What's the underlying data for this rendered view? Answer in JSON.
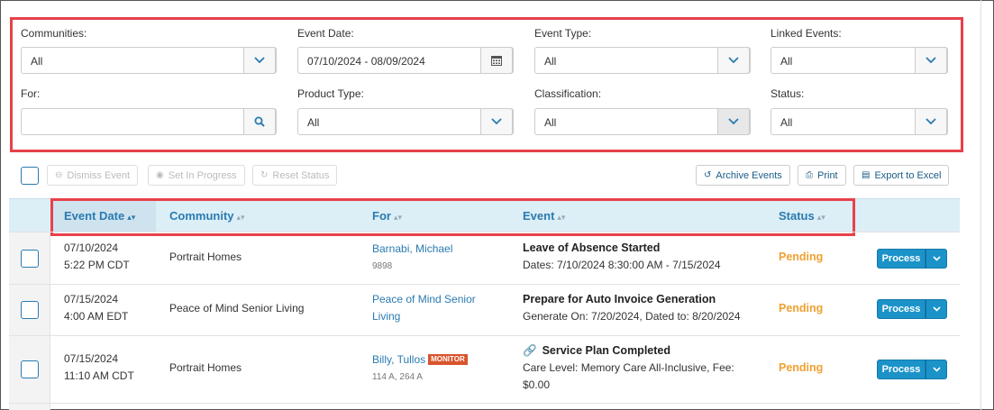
{
  "filters": {
    "communities": {
      "label": "Communities:",
      "value": "All"
    },
    "event_date": {
      "label": "Event Date:",
      "value": "07/10/2024 - 08/09/2024"
    },
    "event_type": {
      "label": "Event Type:",
      "value": "All"
    },
    "linked_events": {
      "label": "Linked Events:",
      "value": "All"
    },
    "for": {
      "label": "For:",
      "value": ""
    },
    "product_type": {
      "label": "Product Type:",
      "value": "All"
    },
    "classification": {
      "label": "Classification:",
      "value": "All"
    },
    "status": {
      "label": "Status:",
      "value": "All"
    }
  },
  "toolbar": {
    "dismiss": "Dismiss Event",
    "set_in_progress": "Set In Progress",
    "reset_status": "Reset Status",
    "archive": "Archive Events",
    "print": "Print",
    "export": "Export to Excel"
  },
  "table": {
    "headers": {
      "event_date": "Event Date",
      "community": "Community",
      "for": "For",
      "event": "Event",
      "status": "Status"
    },
    "rows": [
      {
        "date": "07/10/2024",
        "time": "5:22 PM CDT",
        "community": "Portrait Homes",
        "for_name": "Barnabi, Michael",
        "for_sub": "9898",
        "event_title": "Leave of Absence Started",
        "event_detail": "Dates: 7/10/2024 8:30:00 AM - 7/15/2024",
        "status": "Pending",
        "action": "Process"
      },
      {
        "date": "07/15/2024",
        "time": "4:00 AM EDT",
        "community": "Peace of Mind Senior Living",
        "for_name_line1": "Peace of Mind Senior",
        "for_name_line2": "Living",
        "event_title": "Prepare for Auto Invoice Generation",
        "event_detail": "Generate On: 7/20/2024, Dated to: 8/20/2024",
        "status": "Pending",
        "action": "Process"
      },
      {
        "date": "07/15/2024",
        "time": "11:10 AM CDT",
        "community": "Portrait Homes",
        "for_name": "Billy, Tullos",
        "badge": "MONITOR",
        "for_sub": "114 A, 264 A",
        "event_title": "Service Plan Completed",
        "event_detail_line1": "Care Level: Memory Care All-Inclusive, Fee:",
        "event_detail_line2": "$0.00",
        "status": "Pending",
        "action": "Process"
      }
    ]
  },
  "colors": {
    "accent": "#2a7ab0",
    "pending": "#f0a030",
    "highlight": "#e8414a",
    "button": "#1b93c9",
    "badge": "#d9542c"
  }
}
